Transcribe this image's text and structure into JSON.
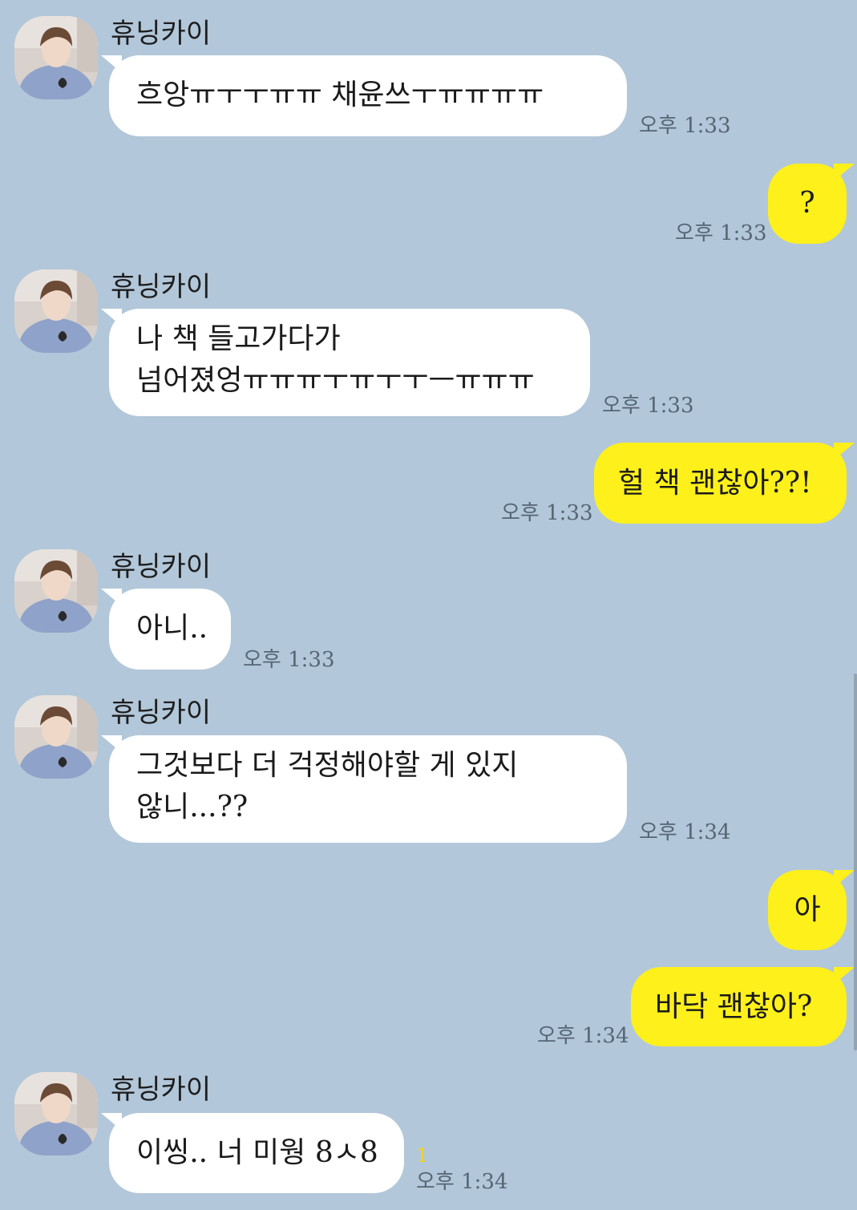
{
  "sender_name": "휴닝카이",
  "messages": [
    {
      "dir": "in",
      "lines": [
        "흐앙ㅠㅜㅜㅠㅠ 채윤쓰ㅜㅠㅠㅠㅠ"
      ],
      "time": "오후 1:33"
    },
    {
      "dir": "out",
      "lines": [
        "?"
      ],
      "time": "오후 1:33"
    },
    {
      "dir": "in",
      "lines": [
        "나 책 들고가다가",
        "넘어졌엉ㅠㅠㅠㅜㅠㅜㅜㅡㅠㅠㅠ"
      ],
      "time": "오후 1:33"
    },
    {
      "dir": "out",
      "lines": [
        "헐 책 괜찮아??!"
      ],
      "time": "오후 1:33"
    },
    {
      "dir": "in",
      "lines": [
        "아니.."
      ],
      "time": "오후 1:33"
    },
    {
      "dir": "in",
      "lines": [
        "그것보다 더 걱정해야할 게 있지",
        "않니...??"
      ],
      "time": "오후 1:34"
    },
    {
      "dir": "out",
      "lines": [
        "아"
      ],
      "time": ""
    },
    {
      "dir": "out",
      "lines": [
        "바닥 괜찮아?"
      ],
      "time": "오후 1:34"
    },
    {
      "dir": "in",
      "lines": [
        "이씽.. 너 미웡 8ㅅ8"
      ],
      "time": "오후 1:34",
      "unread": "1"
    }
  ],
  "colors": {
    "background": "#b2c7d9",
    "incoming_bubble": "#ffffff",
    "outgoing_bubble": "#fef01b",
    "unread_count": "#f3d31b"
  }
}
